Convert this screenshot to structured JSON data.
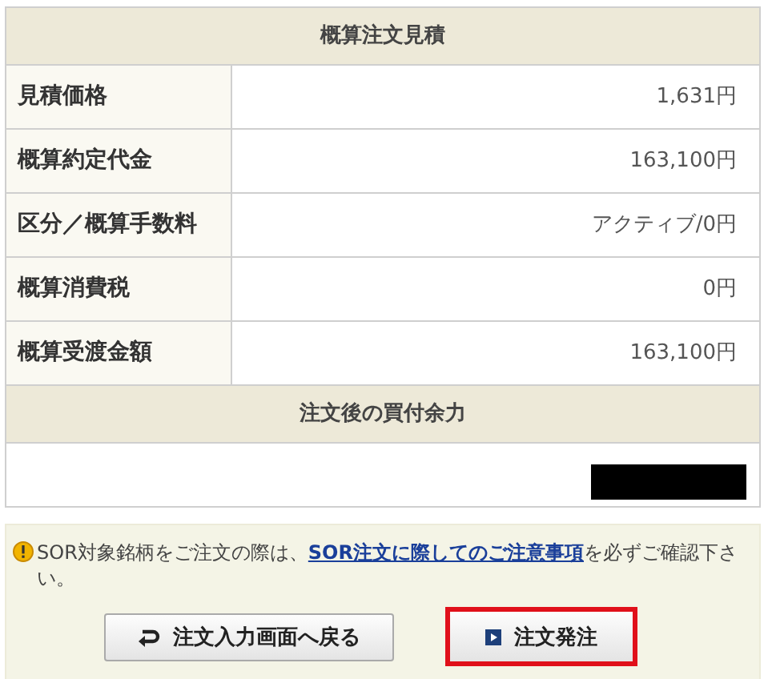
{
  "estimate": {
    "title": "概算注文見積",
    "rows": [
      {
        "label": "見積価格",
        "value": "1,631円"
      },
      {
        "label": "概算約定代金",
        "value": "163,100円"
      },
      {
        "label": "区分／概算手数料",
        "value": "アクティブ/0円"
      },
      {
        "label": "概算消費税",
        "value": "0円"
      },
      {
        "label": "概算受渡金額",
        "value": "163,100円"
      }
    ]
  },
  "buying_power": {
    "title": "注文後の買付余力",
    "redacted": true
  },
  "notice": {
    "before": "SOR対象銘柄をご注文の際は、",
    "link": "SOR注文に際してのご注意事項",
    "after": "を必ずご確認下さい。"
  },
  "buttons": [
    {
      "label": "注文入力画面へ戻る",
      "kind": "back",
      "highlighted": false
    },
    {
      "label": "注文発注",
      "kind": "submit",
      "highlighted": true
    }
  ]
}
